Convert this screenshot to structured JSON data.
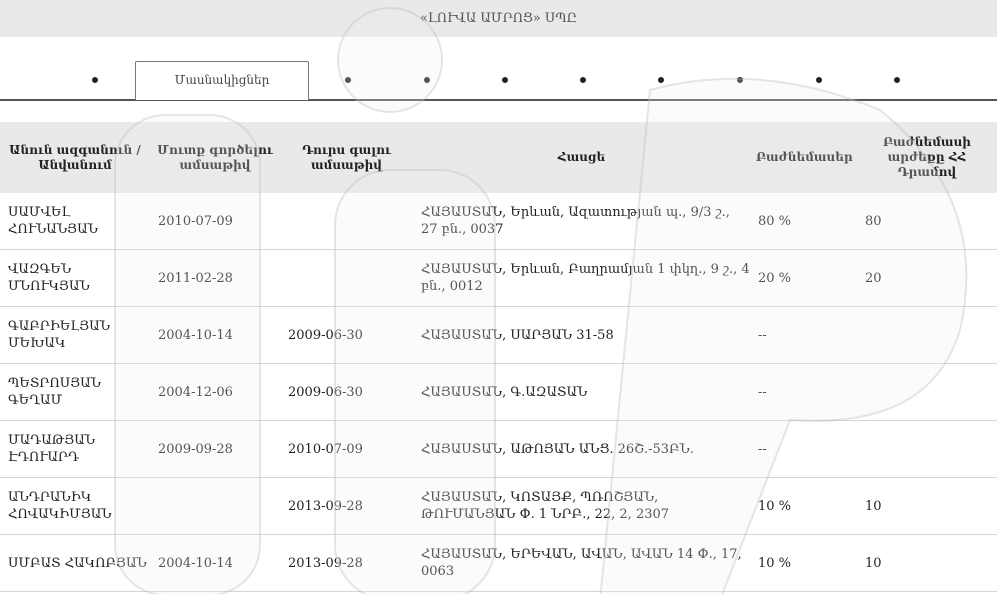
{
  "header": {
    "title": "«ԼՈՒՎԱ ԱՄՐՈՑ» ՍՊԸ"
  },
  "tabs": {
    "active_label": "Մասնակիցներ",
    "dot_count": 9
  },
  "table": {
    "columns": [
      "Անուն ազգանուն / Անվանում",
      "Մուտք գործելու ամսաթիվ",
      "Դուրս գալու ամսաթիվ",
      "Հասցե",
      "Բաժնեմասեր",
      "Բաժնեմասի արժեքը ՀՀ Դրամով"
    ],
    "rows": [
      {
        "name": "ՍԱՄՎԵԼ ՀՈՒՆԱՆՅԱՆ",
        "entry": "2010-07-09",
        "exit": "",
        "address": "ՀԱՅԱՍՏԱՆ, Երևան, Ազատության պ., 9/3 շ., 27 բն., 0037",
        "shares": "80 %",
        "value": "80"
      },
      {
        "name": "ՎԱԶԳԵՆ ՄՆՈՒԿՅԱՆ",
        "entry": "2011-02-28",
        "exit": "",
        "address": "ՀԱՅԱՍՏԱՆ, Երևան, Բաղրամյան 1 փկղ., 9 շ., 4 բն., 0012",
        "shares": "20 %",
        "value": "20"
      },
      {
        "name": "ԳԱԲՐԻԵԼՅԱՆ ՄԵԽԱԿ",
        "entry": "2004-10-14",
        "exit": "2009-06-30",
        "address": "ՀԱՅԱՍՏԱՆ, ՍԱՐՅԱՆ 31-58",
        "shares": "--",
        "value": ""
      },
      {
        "name": "ՊԵՏՐՈՍՅԱՆ ԳԵՂԱՄ",
        "entry": "2004-12-06",
        "exit": "2009-06-30",
        "address": "ՀԱՅԱՍՏԱՆ, Գ.ԱԶԱՏԱՆ",
        "shares": "--",
        "value": ""
      },
      {
        "name": "ՄԱԴԱԹՅԱՆ ԷԴՈՒԱՐԴ",
        "entry": "2009-09-28",
        "exit": "2010-07-09",
        "address": "ՀԱՅԱՍՏԱՆ, ԱԹՈՅԱՆ ԱՆՑ. 26Շ.-53ԲՆ.",
        "shares": "--",
        "value": ""
      },
      {
        "name": "ԱՆԴՐԱՆԻԿ ՀՈՎԱԿԻՄՅԱՆ",
        "entry": "",
        "exit": "2013-09-28",
        "address": "ՀԱՅԱՍՏԱՆ, ԿՈՏԱՅՔ, ՊՌՈՇՅԱՆ, ԹՈՒՄԱՆՅԱՆ Փ. 1 ՆՐԲ., 22, 2, 2307",
        "shares": "10 %",
        "value": "10"
      },
      {
        "name": "ՍՄԲԱՏ ՀԱԿՈԲՅԱՆ",
        "entry": "2004-10-14",
        "exit": "2013-09-28",
        "address": "ՀԱՅԱՍՏԱՆ, ԵՐԵՎԱՆ, ԱՎԱՆ, ԱՎԱՆ 14 Փ., 17, 0063",
        "shares": "10 %",
        "value": "10"
      }
    ]
  }
}
